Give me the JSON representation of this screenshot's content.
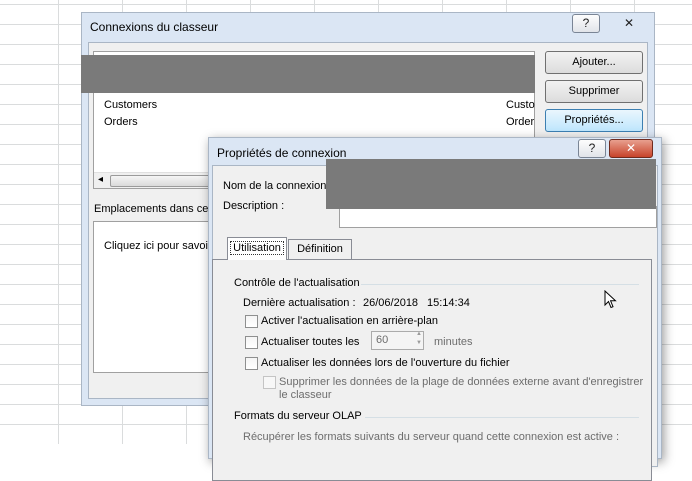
{
  "workbook_connections": {
    "title": "Connexions du classeur",
    "help_glyph": "?",
    "close_glyph": "✕",
    "list_items": [
      {
        "name": "Customers",
        "desc": "Custo"
      },
      {
        "name": "Orders",
        "desc": "Order"
      }
    ],
    "buttons": {
      "add": "Ajouter...",
      "remove": "Supprimer",
      "properties": "Propriétés..."
    },
    "locations_label": "Emplacements dans ce c",
    "locations_hint": "Cliquez ici pour savoir",
    "scroll_left": "◂"
  },
  "connection_properties": {
    "title": "Propriétés de connexion",
    "help_glyph": "?",
    "close_glyph": "✕",
    "name_label": "Nom de la connexion",
    "description_label": "Description :",
    "tabs": [
      "Utilisation",
      "Définition"
    ],
    "refresh_section": "Contrôle de l'actualisation",
    "last_refresh_label": "Dernière actualisation :",
    "last_refresh_date": "26/06/2018",
    "last_refresh_time": "15:14:34",
    "opt_background": "Activer l'actualisation en arrière-plan",
    "opt_every": "Actualiser toutes les",
    "every_value": "60",
    "every_unit": "minutes",
    "opt_on_open": "Actualiser les données lors de l'ouverture du fichier",
    "opt_remove_line1": "Supprimer les données de la plage de données externe avant d'enregistrer",
    "opt_remove_line2": "le classeur",
    "olap_section": "Formats du serveur OLAP",
    "olap_desc": "Récupérer les formats suivants du serveur quand cette connexion est active :",
    "spin_up": "▲",
    "spin_down": "▼"
  }
}
